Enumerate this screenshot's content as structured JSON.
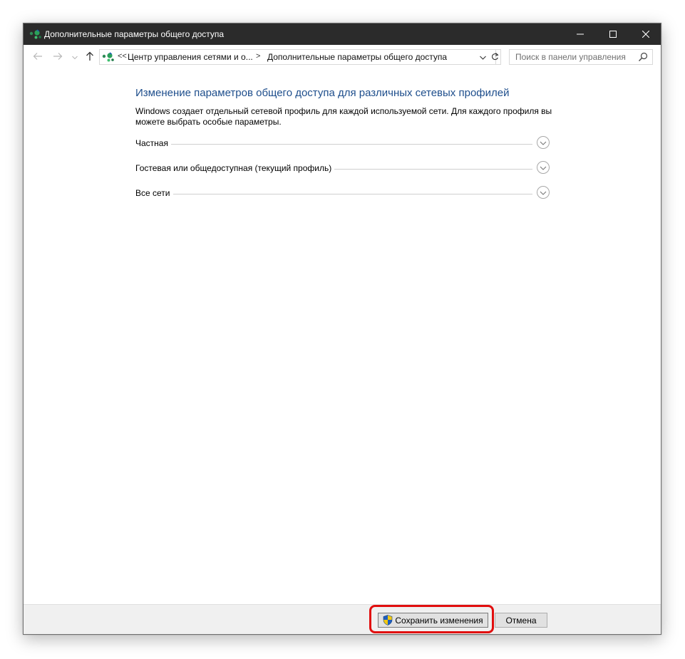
{
  "window": {
    "title": "Дополнительные параметры общего доступа",
    "icon": "network-sharing-icon",
    "controls": {
      "minimize": "minimize-icon",
      "maximize": "maximize-icon",
      "close": "close-icon"
    }
  },
  "navigation": {
    "back_icon": "arrow-left-icon",
    "forward_icon": "arrow-right-icon",
    "recent_icon": "chevron-down-icon",
    "up_icon": "arrow-up-icon",
    "address": {
      "overflow": "<<",
      "crumb1": "Центр управления сетями и о...",
      "separator": ">",
      "crumb2": "Дополнительные параметры общего доступа"
    },
    "refresh_icon": "refresh-icon",
    "search": {
      "placeholder": "Поиск в панели управления",
      "icon": "search-icon"
    }
  },
  "main": {
    "heading": "Изменение параметров общего доступа для различных сетевых профилей",
    "description": "Windows создает отдельный сетевой профиль для каждой используемой сети. Для каждого профиля вы можете выбрать особые параметры.",
    "profiles": [
      {
        "label": "Частная",
        "expanded": false
      },
      {
        "label": "Гостевая или общедоступная (текущий профиль)",
        "expanded": false
      },
      {
        "label": "Все сети",
        "expanded": false
      }
    ]
  },
  "footer": {
    "save_label": "Сохранить изменения",
    "save_icon": "uac-shield-icon",
    "cancel_label": "Отмена",
    "highlight_color": "#e10e0e"
  }
}
